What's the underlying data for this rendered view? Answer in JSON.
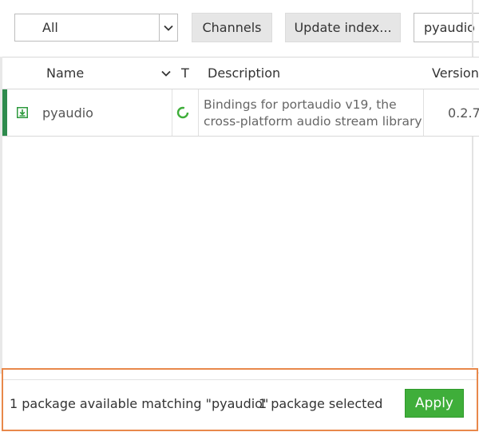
{
  "toolbar": {
    "filter": {
      "selected": "All"
    },
    "channels_label": "Channels",
    "update_index_label": "Update index...",
    "search": {
      "value": "pyaudio",
      "placeholder": ""
    }
  },
  "table": {
    "columns": {
      "name": "Name",
      "type": "T",
      "description": "Description",
      "version": "Version"
    },
    "rows": [
      {
        "name": "pyaudio",
        "status_icon": "install-arrow-icon",
        "type_icon": "loading-spinner-icon",
        "description_line1": "Bindings for portaudio v19, the",
        "description_line2": "cross-platform audio stream library",
        "version": "0.2.7"
      }
    ]
  },
  "footer": {
    "summary": "1 package available matching \"pyaudio\"",
    "selected": "1 package selected",
    "apply_label": "Apply"
  },
  "colors": {
    "accent_green": "#3fae3a",
    "row_marker": "#2e8b4d",
    "highlight_border": "#e8884a"
  }
}
